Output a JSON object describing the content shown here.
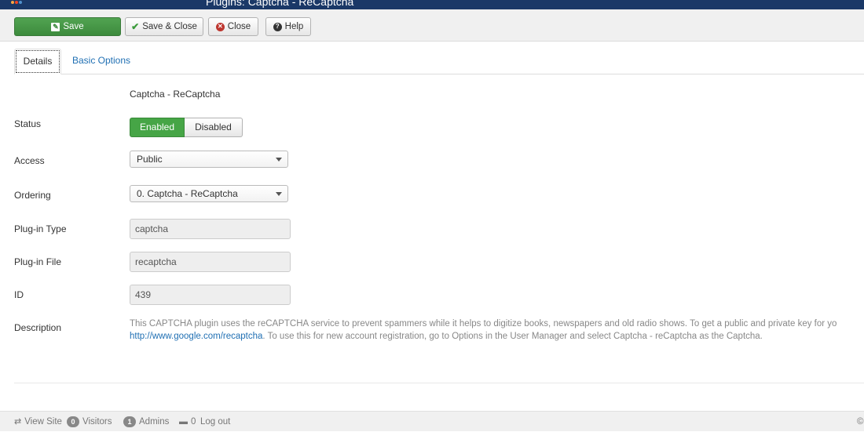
{
  "header": {
    "title": "Plugins: Captcha - ReCaptcha"
  },
  "toolbar": {
    "save_label": "Save",
    "save_close_label": "Save & Close",
    "close_label": "Close",
    "help_label": "Help"
  },
  "tabs": [
    {
      "label": "Details",
      "active": true
    },
    {
      "label": "Basic Options",
      "active": false
    }
  ],
  "form": {
    "plugin_name": "Captcha - ReCaptcha",
    "status": {
      "label": "Status",
      "enabled": "Enabled",
      "disabled": "Disabled",
      "selected": "Enabled"
    },
    "access": {
      "label": "Access",
      "value": "Public"
    },
    "ordering": {
      "label": "Ordering",
      "value": "0. Captcha - ReCaptcha"
    },
    "plugin_type": {
      "label": "Plug-in Type",
      "value": "captcha"
    },
    "plugin_file": {
      "label": "Plug-in File",
      "value": "recaptcha"
    },
    "id": {
      "label": "ID",
      "value": "439"
    },
    "description": {
      "label": "Description",
      "line1": "This CAPTCHA plugin uses the reCAPTCHA service to prevent spammers while it helps to digitize books, newspapers and old radio shows. To get a public and private key for yo",
      "link": "http://www.google.com/recaptcha",
      "line2_rest": ". To use this for new account registration, go to Options in the User Manager and select Captcha - reCaptcha as the Captcha."
    }
  },
  "statusbar": {
    "view_site": "View Site",
    "visitors_count": "0",
    "visitors_label": "Visitors",
    "admins_count": "1",
    "admins_label": "Admins",
    "messages_count": "0",
    "logout_label": "Log out",
    "copyright": "©"
  },
  "colors": {
    "header_bg": "#1a3867",
    "save_green": "#46a546",
    "link_blue": "#1f6fb3"
  }
}
